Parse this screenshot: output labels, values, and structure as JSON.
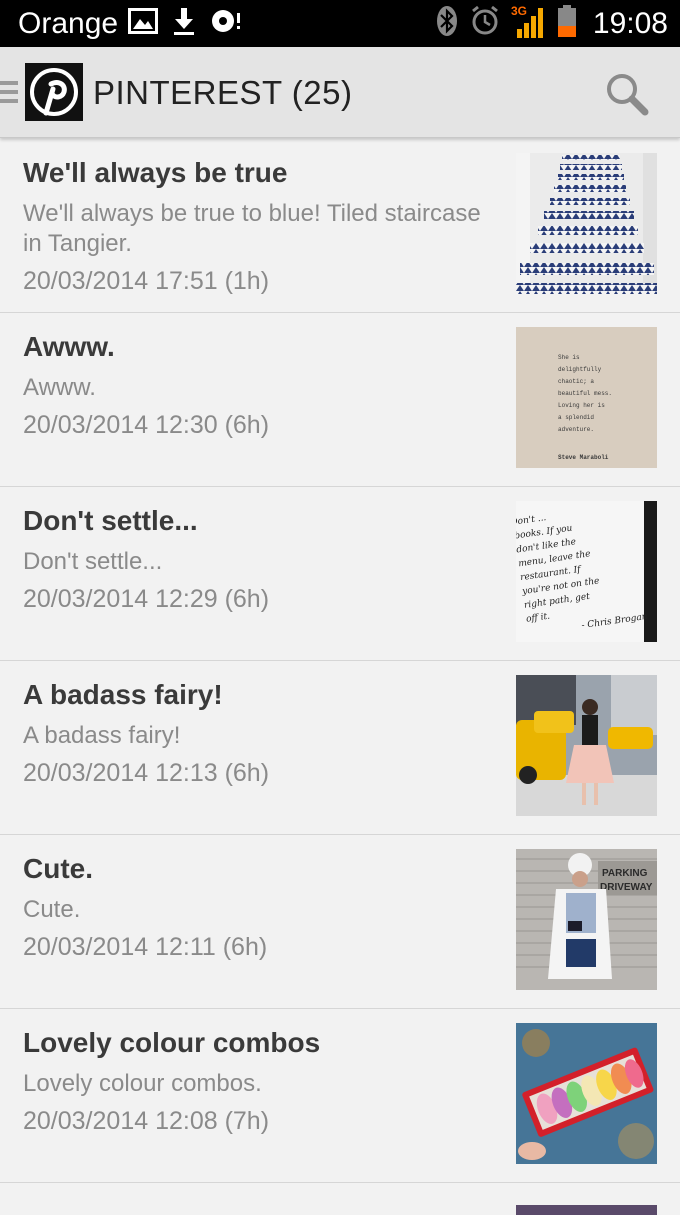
{
  "status_bar": {
    "carrier": "Orange",
    "network": "3G",
    "time": "19:08",
    "icons": [
      "image-icon",
      "download-icon",
      "media-icon",
      "bluetooth-icon",
      "alarm-icon",
      "signal-icon",
      "battery-icon"
    ],
    "battery_color": "#ff6a00",
    "signal_color": "#f6a800"
  },
  "app_bar": {
    "title": "PINTEREST (25)",
    "logo": "pinterest-logo-icon",
    "search_icon": "search-icon"
  },
  "feed": [
    {
      "title": "We'll always be true",
      "description": "We'll always be true to blue! Tiled staircase in Tangier.",
      "timestamp": "20/03/2014 17:51 (1h)",
      "thumbnail": "tiled-staircase-image"
    },
    {
      "title": "Awww.",
      "description": "Awww.",
      "timestamp": "20/03/2014 12:30 (6h)",
      "thumbnail": "quote-card-image"
    },
    {
      "title": "Don't settle...",
      "description": "Don't settle...",
      "timestamp": "20/03/2014 12:29 (6h)",
      "thumbnail": "handwritten-quote-image"
    },
    {
      "title": "A badass fairy!",
      "description": "A badass fairy!",
      "timestamp": "20/03/2014 12:13 (6h)",
      "thumbnail": "street-fashion-image"
    },
    {
      "title": "Cute.",
      "description": "Cute.",
      "timestamp": "20/03/2014 12:11 (6h)",
      "thumbnail": "winter-outfit-image"
    },
    {
      "title": "Lovely colour combos",
      "description": "Lovely colour combos.",
      "timestamp": "20/03/2014 12:08 (7h)",
      "thumbnail": "macarons-box-image"
    }
  ],
  "quote_card": {
    "lines": [
      "She is",
      "delightfully",
      "chaotic; a",
      "beautiful mess.",
      "Loving her is",
      "a splendid",
      "adventure."
    ],
    "author": "Steve Maraboli"
  },
  "handwritten_quote": {
    "lines": [
      "Don't ...",
      "books. If you",
      "don't like the",
      "menu, leave the",
      "restaurant. If",
      "you're not on the",
      "right path, get",
      "off it."
    ],
    "author": "- Chris Brogan"
  },
  "winter_sign": {
    "lines": [
      "PARKING",
      "DRIVEWAY"
    ]
  }
}
